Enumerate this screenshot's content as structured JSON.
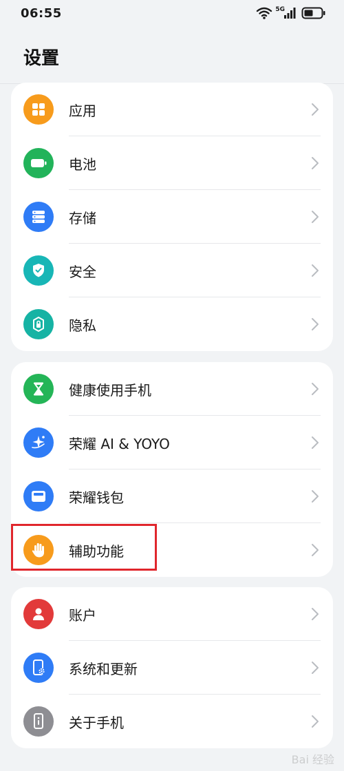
{
  "status_bar": {
    "time": "06:55",
    "network_label": "5G"
  },
  "header": {
    "title": "设置"
  },
  "groups": [
    {
      "items": [
        {
          "label": "应用",
          "icon": "apps-icon",
          "color": "#f79b1c"
        },
        {
          "label": "电池",
          "icon": "battery-icon",
          "color": "#22b35a"
        },
        {
          "label": "存储",
          "icon": "storage-icon",
          "color": "#2f7cf6"
        },
        {
          "label": "安全",
          "icon": "shield-check-icon",
          "color": "#18b6b6"
        },
        {
          "label": "隐私",
          "icon": "privacy-lock-icon",
          "color": "#16b3a4"
        }
      ]
    },
    {
      "items": [
        {
          "label": "健康使用手机",
          "icon": "hourglass-icon",
          "color": "#24b557"
        },
        {
          "label": "荣耀 AI & YOYO",
          "icon": "ai-sparkle-icon",
          "color": "#2f7cf6"
        },
        {
          "label": "荣耀钱包",
          "icon": "wallet-icon",
          "color": "#2f7cf6"
        },
        {
          "label": "辅助功能",
          "icon": "hand-icon",
          "color": "#f79b1c"
        }
      ]
    },
    {
      "items": [
        {
          "label": "账户",
          "icon": "account-icon",
          "color": "#e23a3a"
        },
        {
          "label": "系统和更新",
          "icon": "system-update-icon",
          "color": "#2f7cf6"
        },
        {
          "label": "关于手机",
          "icon": "phone-info-icon",
          "color": "#8e8e93"
        }
      ]
    }
  ],
  "highlighted_item": "辅助功能",
  "watermark": "Bai 经验"
}
